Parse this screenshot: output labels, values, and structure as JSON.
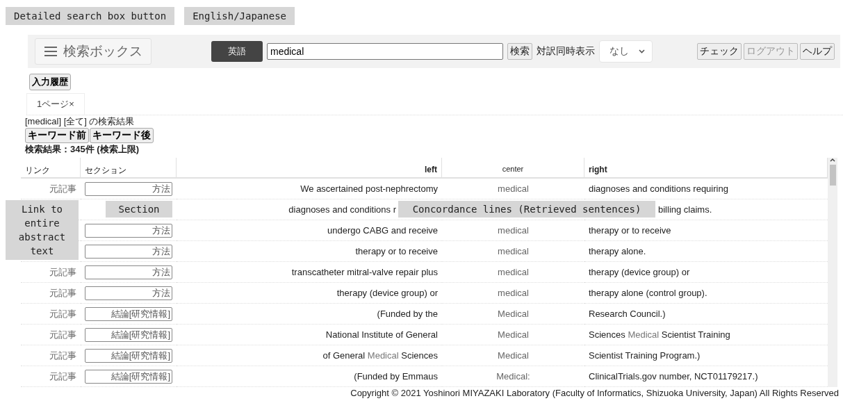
{
  "callouts_top": [
    "Detailed search box button",
    "English/Japanese"
  ],
  "header": {
    "menu_label": "検索ボックス",
    "language": "英語",
    "query": "medical",
    "search_button": "検索",
    "parallel_label": "対訳同時表示",
    "parallel_select": "なし",
    "actions": [
      {
        "label": "チェック",
        "disabled": false
      },
      {
        "label": "ログアウト",
        "disabled": true
      },
      {
        "label": "ヘルプ",
        "disabled": false
      }
    ]
  },
  "history_button": "入力履歴",
  "tabs": [
    {
      "label": "1ページ×",
      "selected": true
    }
  ],
  "results_title": "[medical] [全て] の検索結果",
  "keyword_buttons": [
    "キーワード前",
    "キーワード後"
  ],
  "results_count": "検索結果：345件 (検索上限)",
  "table": {
    "columns": [
      "リンク",
      "セクション",
      "left",
      "center",
      "right"
    ],
    "rows": [
      {
        "link": "元記事",
        "section": "方法",
        "left": "We ascertained post-nephrectomy",
        "center": "medical",
        "right": "diagnoses and conditions requiring"
      },
      {
        "left": "diagnoses and conditions r",
        "right": "billing claims."
      },
      {
        "section": "方法",
        "left": "undergo CABG and receive",
        "center": "medical",
        "right": "therapy or to receive"
      },
      {
        "section": "方法",
        "left": "therapy or to receive",
        "center": "medical",
        "right": "therapy alone."
      },
      {
        "link": "元記事",
        "section": "方法",
        "left": "transcatheter mitral-valve repair plus",
        "center": "medical",
        "right": "therapy (device group) or"
      },
      {
        "link": "元記事",
        "section": "方法",
        "left": "therapy (device group) or",
        "center": "medical",
        "right": "therapy alone (control group)."
      },
      {
        "link": "元記事",
        "section": "結論[研究情報]",
        "left": "(Funded by the",
        "center": "Medical",
        "right": "Research Council.)"
      },
      {
        "link": "元記事",
        "section": "結論[研究情報]",
        "left": "National Institute of General",
        "center": "Medical",
        "right": [
          {
            "text": "Sciences ",
            "hit": false
          },
          {
            "text": "Medical",
            "hit": true
          },
          {
            "text": " Scientist Training",
            "hit": false
          }
        ]
      },
      {
        "link": "元記事",
        "section": "結論[研究情報]",
        "left": [
          {
            "text": "of General ",
            "hit": false
          },
          {
            "text": "Medical",
            "hit": true
          },
          {
            "text": " Sciences",
            "hit": false
          }
        ],
        "center": "Medical",
        "right": "Scientist Training Program.)"
      },
      {
        "link": "元記事",
        "section": "結論[研究情報]",
        "left": "(Funded by Emmaus",
        "center": "Medical:",
        "right": "ClinicalTrials.gov number, NCT01179217.)"
      }
    ]
  },
  "callouts_overlay": [
    "Link to entire abstract text",
    "Section",
    "Concordance lines (Retrieved sentences)"
  ],
  "footer": "Copyright © 2021 Yoshinori MIYAZAKI Laboratory (Faculty of Informatics, Shizuoka University, Japan) All Rights Reserved"
}
